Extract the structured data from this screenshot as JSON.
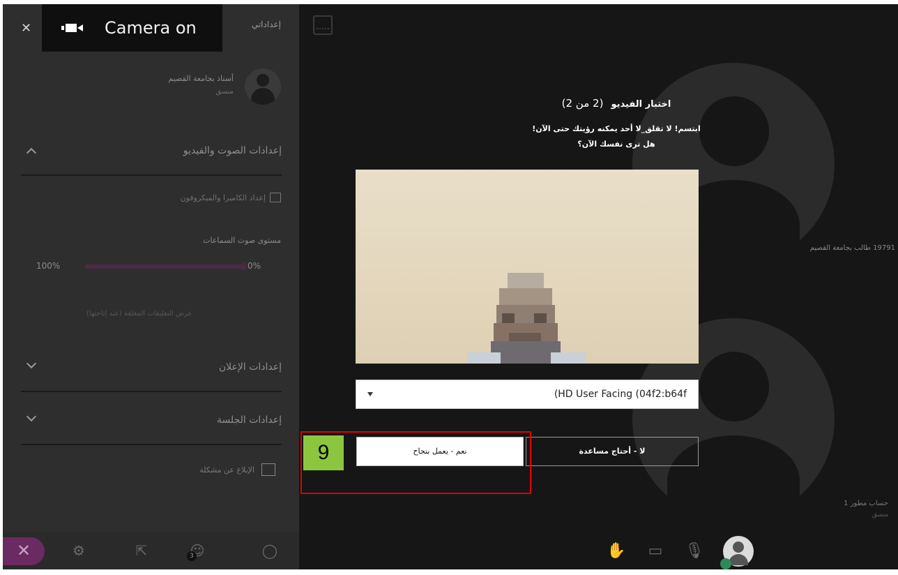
{
  "toast": {
    "text": "Camera on"
  },
  "panel": {
    "header_title": "إعداداتي",
    "user": {
      "name": "أستاذ بجامعة القصيم",
      "role": "منسق"
    },
    "sections": {
      "audio_video": "إعدادات الصوت والفيديو",
      "notifications": "إعدادات الإعلان",
      "session": "إعدادات الجلسة"
    },
    "camera_setup": "إعداد الكاميرا والميكروفون",
    "speaker_volume_label": "مستوى صوت السماعات",
    "volume_max": "100%",
    "volume_min": "0%",
    "volume_level": 1.0,
    "captions_text": "عرض التعليقات المغلقة (عند إتاحتها)",
    "report_issue": "الإبلاغ عن مشكلة",
    "participants_badge": "3"
  },
  "dialog": {
    "title": "اختبار الفيديو",
    "step": "(2 من 2)",
    "message_line1": "ابتسم! لا تقلق_لا أحد يمكنه رؤيتك حتى الآن!",
    "message_line2": "هل ترى نفسك الآن؟",
    "device_selected": "(HD User Facing (04f2:b64f",
    "btn_yes": "نعم - يعمل بنجاح",
    "btn_no": "لا - أحتاج مساعدة"
  },
  "participants": {
    "student_label": "19791 طالب بجامعة القصيم",
    "account_name": "حساب مطور 1",
    "account_role": "منسق"
  },
  "annotation": {
    "step_number": "9",
    "highlight_color": "#e00000",
    "badge_color": "#8cc63f"
  },
  "colors": {
    "accent": "#6a2b63",
    "background": "#161616",
    "panel": "#2e2e2e"
  }
}
